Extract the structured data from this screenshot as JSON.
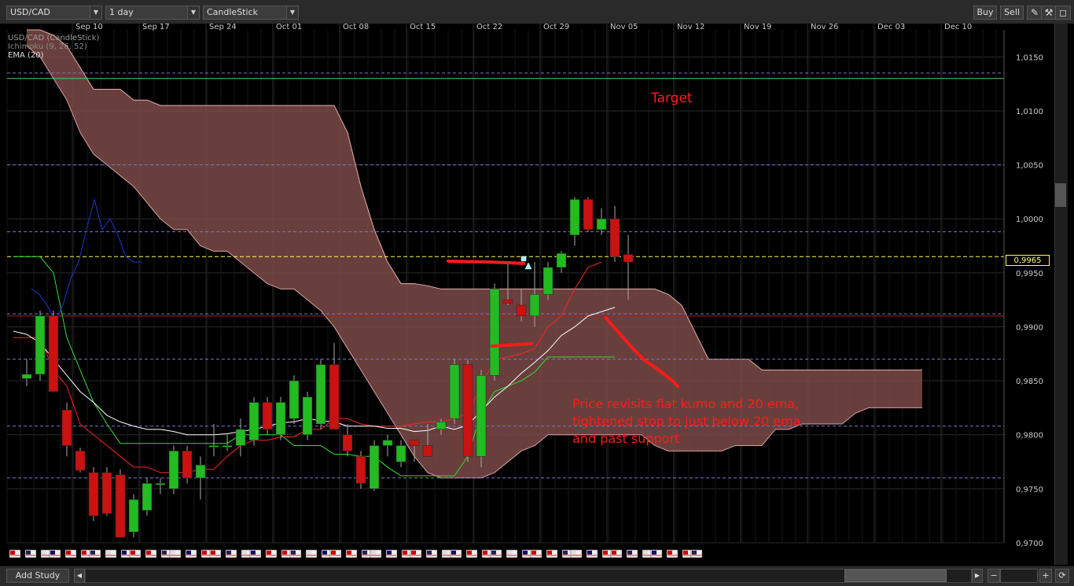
{
  "toolbar": {
    "symbol": "USD/CAD",
    "period": "1 day",
    "chart_type": "CandleStick",
    "buy_label": "Buy",
    "sell_label": "Sell",
    "draw_icon": "pencil-icon",
    "settings_icon": "wrench-icon",
    "window_icon": "maximize-icon"
  },
  "legend": {
    "line1": "USD/CAD (CandleStick)",
    "line2": "Ichimoku (9, 26, 52)",
    "line3": "EMA (20)"
  },
  "annotations": {
    "target": "Target",
    "note_line1": "Price revisits flat kumo and 20 ema,",
    "note_line2": "tightened stop to just below 20 ema",
    "note_line3": "and past support"
  },
  "bottombar": {
    "add_study_label": "Add Study",
    "zoom_out": "−",
    "zoom_in": "+"
  },
  "colors": {
    "bull": "#22bb22",
    "bear": "#cc1111",
    "kumo_fill": "#7a4a46",
    "ema": "#ffffff",
    "tenkan": "#ff2222",
    "kijun": "#33dd33",
    "chikou": "#2233cc",
    "annotation": "#ff1a1a",
    "current_price": "#ffff55"
  },
  "chart_data": {
    "type": "candlestick",
    "title": "USD/CAD (CandleStick)",
    "current_price": "0,9965",
    "x_tick_labels": [
      "Sep 10",
      "Sep 17",
      "Sep 24",
      "Oct 01",
      "Oct 08",
      "Oct 15",
      "Oct 22",
      "Oct 29",
      "Nov 05",
      "Nov 12",
      "Nov 19",
      "Nov 26",
      "Dec 03",
      "Dec 10"
    ],
    "y_tick_labels": [
      "1,0150",
      "1,0100",
      "1,0050",
      "1,0000",
      "0,9950",
      "0,9900",
      "0,9850",
      "0,9800",
      "0,9750",
      "0,9700"
    ],
    "ylim": [
      0.97,
      1.0175
    ],
    "candles": [
      {
        "o": 0.9852,
        "h": 0.987,
        "l": 0.9845,
        "c": 0.9856
      },
      {
        "o": 0.9856,
        "h": 0.9915,
        "l": 0.985,
        "c": 0.991
      },
      {
        "o": 0.991,
        "h": 0.9915,
        "l": 0.984,
        "c": 0.984
      },
      {
        "o": 0.9823,
        "h": 0.983,
        "l": 0.978,
        "c": 0.979
      },
      {
        "o": 0.9785,
        "h": 0.9788,
        "l": 0.9765,
        "c": 0.9767
      },
      {
        "o": 0.9765,
        "h": 0.977,
        "l": 0.972,
        "c": 0.9725
      },
      {
        "o": 0.9765,
        "h": 0.977,
        "l": 0.9725,
        "c": 0.9727
      },
      {
        "o": 0.9763,
        "h": 0.9768,
        "l": 0.9705,
        "c": 0.9705
      },
      {
        "o": 0.971,
        "h": 0.9745,
        "l": 0.9705,
        "c": 0.974
      },
      {
        "o": 0.973,
        "h": 0.976,
        "l": 0.9725,
        "c": 0.9755
      },
      {
        "o": 0.9755,
        "h": 0.976,
        "l": 0.9745,
        "c": 0.9755
      },
      {
        "o": 0.975,
        "h": 0.979,
        "l": 0.9745,
        "c": 0.9785
      },
      {
        "o": 0.9785,
        "h": 0.979,
        "l": 0.9755,
        "c": 0.976
      },
      {
        "o": 0.976,
        "h": 0.978,
        "l": 0.974,
        "c": 0.9772
      },
      {
        "o": 0.979,
        "h": 0.981,
        "l": 0.978,
        "c": 0.979
      },
      {
        "o": 0.979,
        "h": 0.98,
        "l": 0.9785,
        "c": 0.979
      },
      {
        "o": 0.979,
        "h": 0.9815,
        "l": 0.978,
        "c": 0.9805
      },
      {
        "o": 0.9795,
        "h": 0.9835,
        "l": 0.979,
        "c": 0.983
      },
      {
        "o": 0.983,
        "h": 0.9835,
        "l": 0.98,
        "c": 0.9805
      },
      {
        "o": 0.98,
        "h": 0.9835,
        "l": 0.9795,
        "c": 0.983
      },
      {
        "o": 0.9815,
        "h": 0.9855,
        "l": 0.981,
        "c": 0.985
      },
      {
        "o": 0.98,
        "h": 0.984,
        "l": 0.9795,
        "c": 0.9835
      },
      {
        "o": 0.981,
        "h": 0.987,
        "l": 0.9805,
        "c": 0.9865
      },
      {
        "o": 0.9865,
        "h": 0.9885,
        "l": 0.981,
        "c": 0.9805
      },
      {
        "o": 0.98,
        "h": 0.981,
        "l": 0.978,
        "c": 0.9785
      },
      {
        "o": 0.978,
        "h": 0.9785,
        "l": 0.975,
        "c": 0.9755
      },
      {
        "o": 0.975,
        "h": 0.9795,
        "l": 0.9748,
        "c": 0.979
      },
      {
        "o": 0.979,
        "h": 0.98,
        "l": 0.978,
        "c": 0.9795
      },
      {
        "o": 0.9775,
        "h": 0.9795,
        "l": 0.977,
        "c": 0.979
      },
      {
        "o": 0.9795,
        "h": 0.979,
        "l": 0.9775,
        "c": 0.979
      },
      {
        "o": 0.979,
        "h": 0.981,
        "l": 0.9785,
        "c": 0.978
      },
      {
        "o": 0.9805,
        "h": 0.9815,
        "l": 0.98,
        "c": 0.9812
      },
      {
        "o": 0.9815,
        "h": 0.987,
        "l": 0.981,
        "c": 0.9865
      },
      {
        "o": 0.9865,
        "h": 0.987,
        "l": 0.9775,
        "c": 0.978
      },
      {
        "o": 0.978,
        "h": 0.986,
        "l": 0.977,
        "c": 0.9855
      },
      {
        "o": 0.9855,
        "h": 0.994,
        "l": 0.985,
        "c": 0.9935
      },
      {
        "o": 0.9925,
        "h": 0.996,
        "l": 0.992,
        "c": 0.9922
      },
      {
        "o": 0.992,
        "h": 0.9935,
        "l": 0.9905,
        "c": 0.991
      },
      {
        "o": 0.991,
        "h": 0.996,
        "l": 0.99,
        "c": 0.993
      },
      {
        "o": 0.993,
        "h": 0.996,
        "l": 0.9925,
        "c": 0.9955
      },
      {
        "o": 0.9955,
        "h": 0.997,
        "l": 0.995,
        "c": 0.9968
      },
      {
        "o": 0.9985,
        "h": 1.002,
        "l": 0.9975,
        "c": 1.0018
      },
      {
        "o": 1.0018,
        "h": 1.002,
        "l": 0.9988,
        "c": 0.999
      },
      {
        "o": 0.999,
        "h": 1.001,
        "l": 0.9985,
        "c": 1.0
      },
      {
        "o": 1.0,
        "h": 1.0012,
        "l": 0.996,
        "c": 0.9965
      },
      {
        "o": 0.9967,
        "h": 0.9985,
        "l": 0.9925,
        "c": 0.996
      }
    ],
    "ema20": [
      0.9896,
      0.9893,
      0.9885,
      0.987,
      0.9855,
      0.984,
      0.983,
      0.9818,
      0.9812,
      0.9808,
      0.9805,
      0.9805,
      0.9803,
      0.98,
      0.98,
      0.98,
      0.9801,
      0.9803,
      0.9805,
      0.9808,
      0.9811,
      0.9812,
      0.9815,
      0.9813,
      0.9812,
      0.9808,
      0.9808,
      0.9808,
      0.9806,
      0.9806,
      0.9803,
      0.9804,
      0.9808,
      0.9805,
      0.9809,
      0.9822,
      0.9835,
      0.9845,
      0.9857,
      0.9867,
      0.9878,
      0.9892,
      0.99,
      0.991,
      0.9914,
      0.9918
    ],
    "tenkan": [
      0.989,
      0.989,
      0.989,
      0.986,
      0.9845,
      0.981,
      0.98,
      0.979,
      0.978,
      0.977,
      0.977,
      0.9765,
      0.9765,
      0.9765,
      0.9768,
      0.9768,
      0.978,
      0.979,
      0.9795,
      0.9795,
      0.9798,
      0.9798,
      0.9805,
      0.9805,
      0.9815,
      0.9815,
      0.981,
      0.9808,
      0.9808,
      0.9808,
      0.981,
      0.9812,
      0.9812,
      0.9815,
      0.982,
      0.9845,
      0.987,
      0.9872,
      0.9875,
      0.988,
      0.99,
      0.991,
      0.9935,
      0.9955,
      0.996
    ],
    "kijun": [
      0.9965,
      0.9965,
      0.9965,
      0.995,
      0.989,
      0.986,
      0.983,
      0.981,
      0.9792,
      0.9792,
      0.9792,
      0.9792,
      0.9792,
      0.9792,
      0.9792,
      0.9792,
      0.9792,
      0.98,
      0.98,
      0.98,
      0.98,
      0.979,
      0.979,
      0.979,
      0.9782,
      0.9782,
      0.978,
      0.978,
      0.977,
      0.9762,
      0.9762,
      0.9762,
      0.9762,
      0.9762,
      0.978,
      0.982,
      0.984,
      0.9845,
      0.985,
      0.9858,
      0.9872,
      0.9872,
      0.9872,
      0.9872,
      0.9872,
      0.9872
    ],
    "kumo_top": [
      1.0175,
      1.0175,
      1.017,
      1.016,
      1.014,
      1.012,
      1.012,
      1.012,
      1.011,
      1.011,
      1.0105,
      1.0105,
      1.0105,
      1.0105,
      1.0105,
      1.0105,
      1.0105,
      1.0105,
      1.0105,
      1.0105,
      1.0105,
      1.0105,
      1.0105,
      1.0105,
      1.008,
      1.003,
      0.999,
      0.996,
      0.994,
      0.994,
      0.9938,
      0.9935,
      0.9935,
      0.9935,
      0.9935,
      0.9935,
      0.9935,
      0.9935,
      0.9935,
      0.9935,
      0.9935,
      0.9935,
      0.9935,
      0.9935,
      0.9935,
      0.9935,
      0.9935,
      0.9935,
      0.993,
      0.992,
      0.9895,
      0.987,
      0.987,
      0.987,
      0.987,
      0.986,
      0.986,
      0.986,
      0.986,
      0.986,
      0.986,
      0.986,
      0.986,
      0.986,
      0.986,
      0.986,
      0.986,
      0.986
    ],
    "kumo_bottom": [
      1.016,
      1.015,
      1.013,
      1.011,
      1.008,
      1.006,
      1.005,
      1.004,
      1.003,
      1.0015,
      1.0,
      0.999,
      0.999,
      0.9975,
      0.997,
      0.997,
      0.996,
      0.995,
      0.994,
      0.9935,
      0.9935,
      0.9925,
      0.9915,
      0.99,
      0.988,
      0.986,
      0.984,
      0.982,
      0.98,
      0.978,
      0.9765,
      0.976,
      0.976,
      0.976,
      0.976,
      0.9765,
      0.9775,
      0.9785,
      0.979,
      0.98,
      0.98,
      0.98,
      0.98,
      0.98,
      0.98,
      0.98,
      0.98,
      0.979,
      0.9785,
      0.9785,
      0.9785,
      0.9785,
      0.9785,
      0.979,
      0.979,
      0.979,
      0.9805,
      0.9805,
      0.981,
      0.981,
      0.981,
      0.981,
      0.982,
      0.9825,
      0.9825,
      0.9825,
      0.9825,
      0.9825
    ],
    "chikou": [
      0.9935,
      0.993,
      0.992,
      0.9905,
      0.992,
      0.9945,
      0.996,
      0.999,
      1.0018,
      0.999,
      1.0,
      0.9985,
      0.9965,
      0.996,
      0.996
    ],
    "horizontal_levels": [
      1.0135,
      1.005,
      0.9988,
      0.9912,
      0.987,
      0.9808,
      0.976
    ],
    "support_line": 0.991,
    "target_line": 1.013
  }
}
